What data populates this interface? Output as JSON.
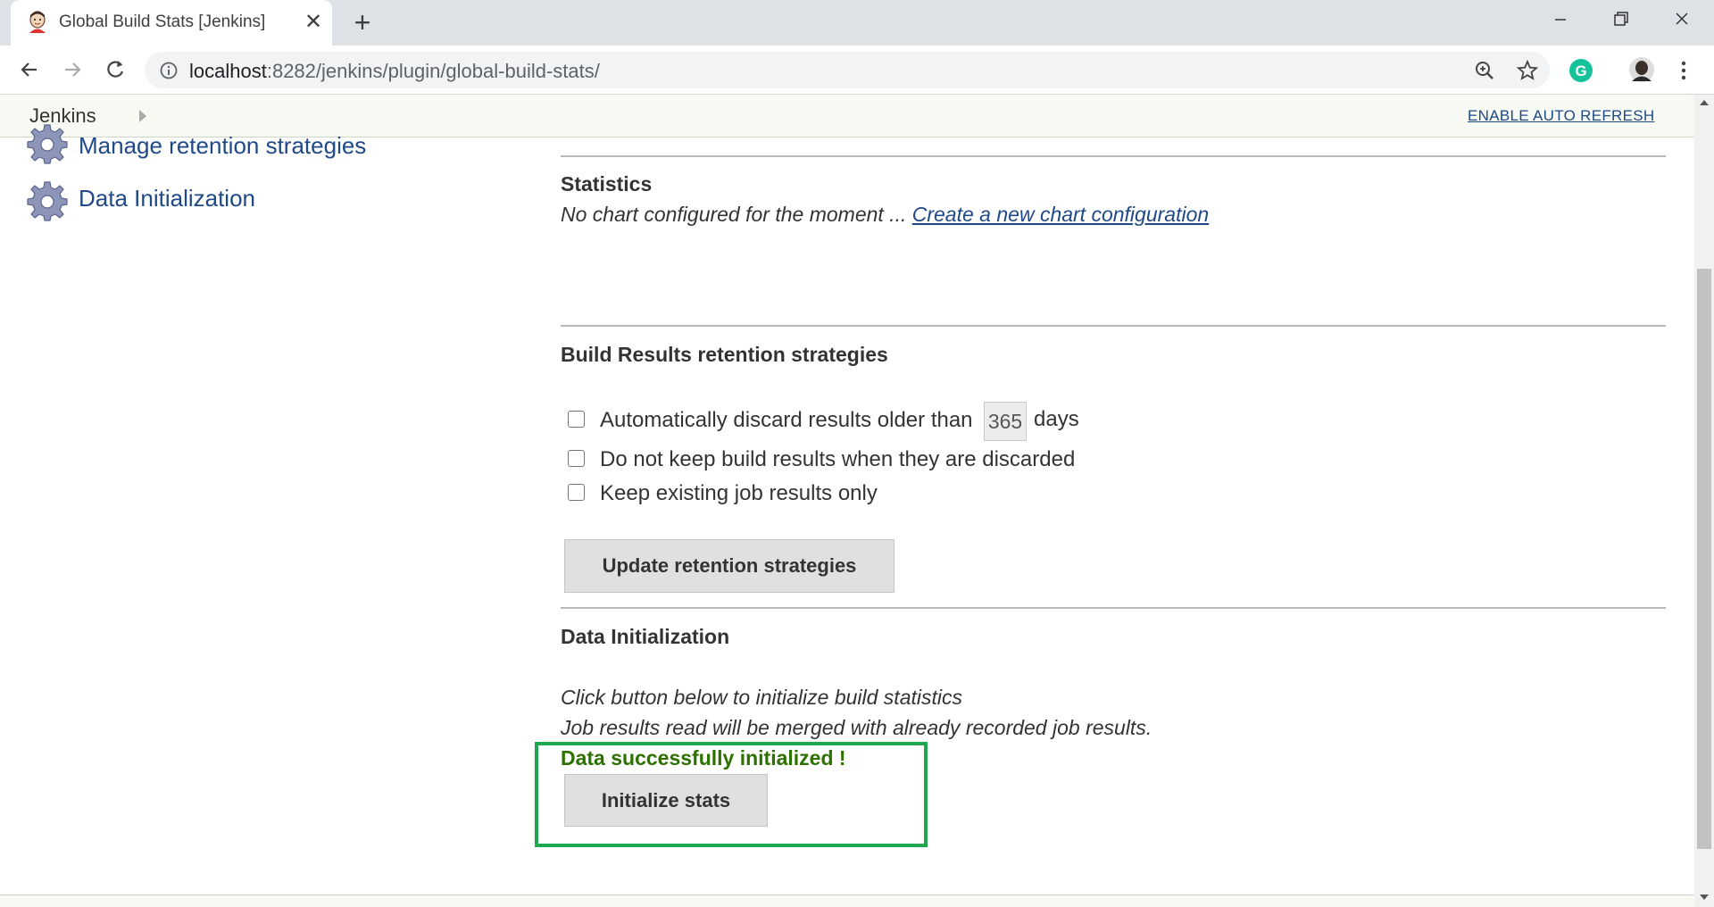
{
  "browser": {
    "tab_title": "Global Build Stats [Jenkins]",
    "url_host": "localhost",
    "url_rest": ":8282/jenkins/plugin/global-build-stats/"
  },
  "jenkins": {
    "breadcrumb": "Jenkins",
    "auto_refresh_link": "ENABLE AUTO REFRESH"
  },
  "sidebar": {
    "items": [
      {
        "label": "Manage retention strategies",
        "icon": "gear-icon"
      },
      {
        "label": "Data Initialization",
        "icon": "gear-icon"
      }
    ]
  },
  "statistics": {
    "heading": "Statistics",
    "empty_text": "No chart configured for the moment ...",
    "create_link": "Create a new chart configuration"
  },
  "retention": {
    "heading": "Build Results retention strategies",
    "opt1_prefix": "Automatically discard results older than",
    "days_value": "365",
    "days_suffix": "days",
    "opt2": "Do not keep build results when they are discarded",
    "opt3": "Keep existing job results only",
    "update_button": "Update retention strategies"
  },
  "data_init": {
    "heading": "Data Initialization",
    "line1": "Click button below to initialize build statistics",
    "line2": "Job results read will be merged with already recorded job results.",
    "success": "Data successfully initialized !",
    "button": "Initialize stats"
  },
  "colors": {
    "link": "#204a87",
    "success": "#2d7100",
    "highlight": "#1fa84f"
  }
}
